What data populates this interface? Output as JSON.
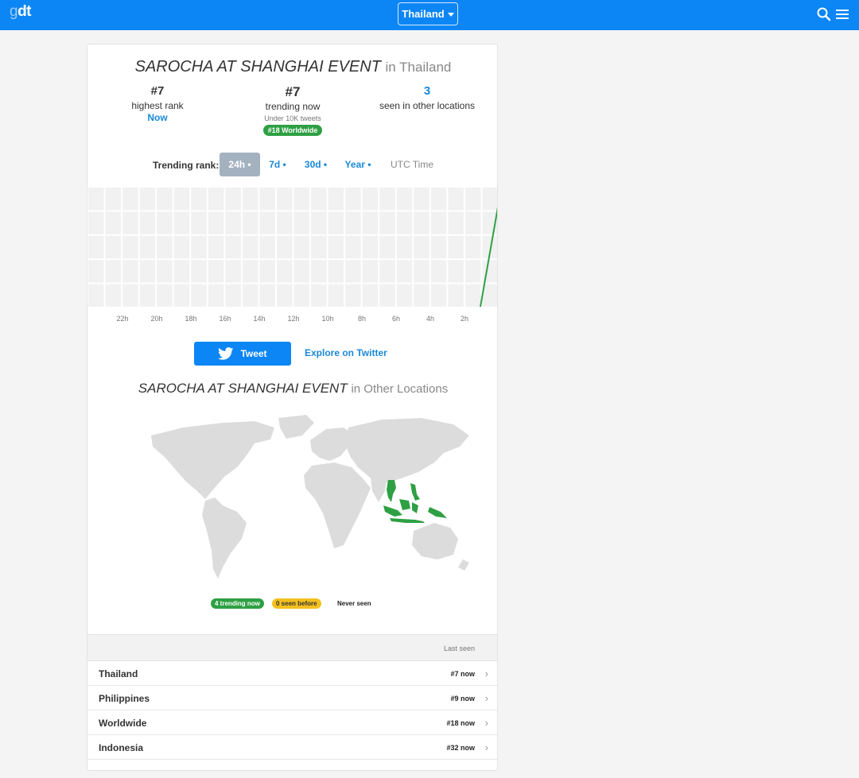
{
  "header": {
    "logo_g": "g",
    "logo_dt": "dt",
    "location_label": "Thailand"
  },
  "trend": {
    "title": "SAROCHA AT SHANGHAI EVENT",
    "title_suffix": "in Thailand",
    "highest_rank_value": "#7",
    "highest_rank_label": "highest rank",
    "highest_rank_when": "Now",
    "trending_now_value": "#7",
    "trending_now_label": "trending now",
    "tweets_note": "Under 10K tweets",
    "worldwide_badge": "#18 Worldwide",
    "other_locations_value": "3",
    "other_locations_label": "seen in other locations"
  },
  "rank_tabs": {
    "label": "Trending rank:",
    "tabs": [
      "24h •",
      "7d •",
      "30d •",
      "Year •"
    ],
    "active": 0,
    "utc_label": "UTC Time"
  },
  "chart_data": {
    "type": "line",
    "x": [
      "22h",
      "20h",
      "18h",
      "16h",
      "14h",
      "12h",
      "10h",
      "8h",
      "6h",
      "4h",
      "2h"
    ],
    "series": [
      {
        "values": [
          null,
          null,
          null,
          null,
          null,
          null,
          null,
          null,
          null,
          null,
          null,
          7
        ]
      }
    ],
    "current_rank": 7,
    "line_color": "#2ea043",
    "grid": true
  },
  "actions": {
    "tweet_label": "Tweet",
    "explore_label": "Explore on Twitter"
  },
  "other_locations": {
    "title": "SAROCHA AT SHANGHAI EVENT",
    "title_suffix": "in Other Locations",
    "highlighted_countries": [
      "Thailand",
      "Philippines",
      "Indonesia"
    ],
    "legend": {
      "trending": "4 trending now",
      "seen_before": "0 seen before",
      "never": "Never seen"
    },
    "last_seen_header": "Last seen",
    "rows": [
      {
        "name": "Thailand",
        "rank": "#7 now"
      },
      {
        "name": "Philippines",
        "rank": "#9 now"
      },
      {
        "name": "Worldwide",
        "rank": "#18 now"
      },
      {
        "name": "Indonesia",
        "rank": "#32 now"
      }
    ]
  },
  "colors": {
    "brand": "#0c86f5",
    "link": "#1a88d8",
    "trending_green": "#2ea043",
    "seen_yellow": "#f4c020"
  }
}
